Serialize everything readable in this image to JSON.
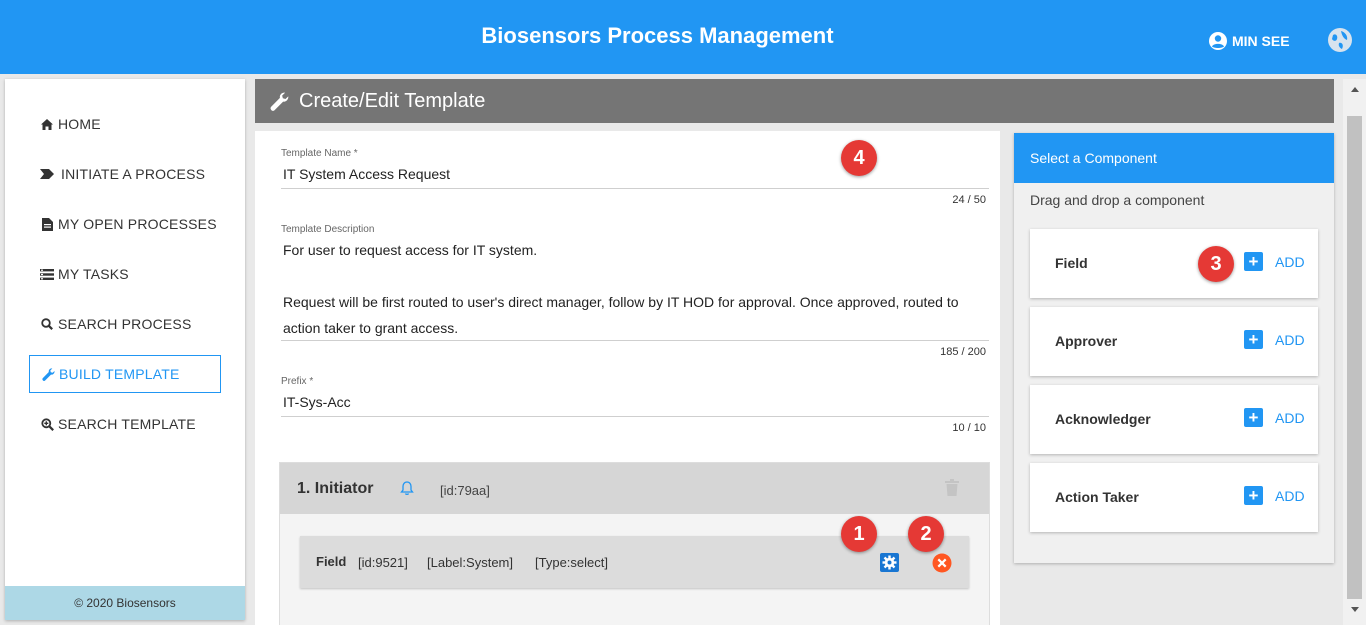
{
  "header": {
    "title": "Biosensors Process Management",
    "user_name": "MIN SEE",
    "user_icon": "account-circle-icon",
    "globe_icon": "globe-icon",
    "color": "#2196f3"
  },
  "sidebar": {
    "items": [
      {
        "label": "HOME",
        "icon": "home-icon"
      },
      {
        "label": "INITIATE A PROCESS",
        "icon": "chevron-right-icon"
      },
      {
        "label": "MY OPEN PROCESSES",
        "icon": "file-icon"
      },
      {
        "label": "MY TASKS",
        "icon": "tasks-icon"
      },
      {
        "label": "SEARCH PROCESS",
        "icon": "search-icon"
      },
      {
        "label": "BUILD TEMPLATE",
        "icon": "wrench-icon",
        "active": true
      },
      {
        "label": "SEARCH TEMPLATE",
        "icon": "search-plus-icon"
      }
    ],
    "footer": "© 2020 Biosensors"
  },
  "page": {
    "title": "Create/Edit Template",
    "title_icon": "wrench-icon"
  },
  "form": {
    "template_name": {
      "label": "Template Name *",
      "value": "IT System Access Request",
      "counter": "24 / 50"
    },
    "template_description": {
      "label": "Template Description",
      "lines": [
        "For user to request access for IT system.",
        "",
        "Request will be first routed to user's direct manager, follow by IT HOD for approval.  Once approved, routed to",
        "action taker to grant access."
      ],
      "counter": "185 / 200"
    },
    "prefix": {
      "label": "Prefix *",
      "value": "IT-Sys-Acc",
      "counter": "10 / 10"
    }
  },
  "initiator": {
    "title": "1. Initiator",
    "id": "[id:79aa]",
    "bell_icon": "bell-icon",
    "trash_icon": "trash-icon",
    "field": {
      "name": "Field",
      "id": "[id:9521]",
      "label": "[Label:System]",
      "type": "[Type:select]",
      "gear_icon": "gear-icon",
      "close_icon": "close-circle-icon"
    }
  },
  "components": {
    "header": "Select a Component",
    "subtitle": "Drag and drop a component",
    "add_label": "ADD",
    "items": [
      {
        "name": "Field"
      },
      {
        "name": "Approver"
      },
      {
        "name": "Acknowledger"
      },
      {
        "name": "Action Taker"
      }
    ]
  },
  "markers": [
    "1",
    "2",
    "3",
    "4"
  ]
}
